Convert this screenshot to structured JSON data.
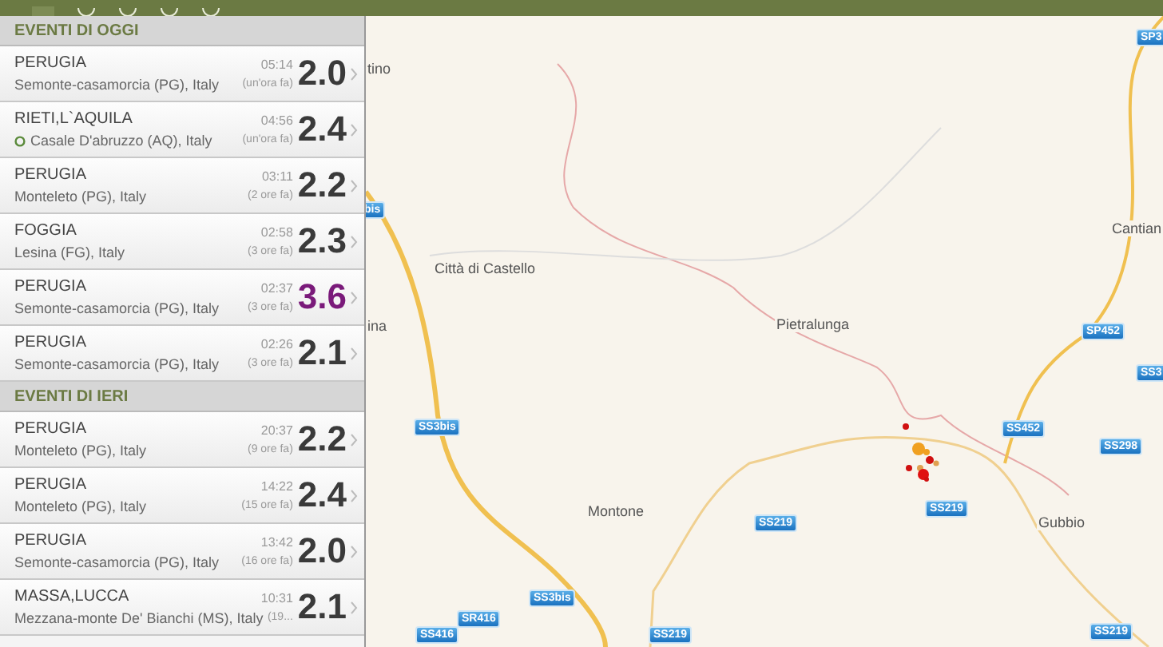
{
  "sections": [
    {
      "title": "EVENTI DI OGGI",
      "events": [
        {
          "region": "PERUGIA",
          "place": "Semonte-casamorcia (PG), Italy",
          "time": "05:14",
          "ago": "(un'ora fa)",
          "magnitude": "2.0",
          "color": "#3a3a3a",
          "marker": false
        },
        {
          "region": "RIETI,L`AQUILA",
          "place": "Casale D'abruzzo (AQ), Italy",
          "time": "04:56",
          "ago": "(un'ora fa)",
          "magnitude": "2.4",
          "color": "#3a3a3a",
          "marker": true
        },
        {
          "region": "PERUGIA",
          "place": "Monteleto (PG), Italy",
          "time": "03:11",
          "ago": "(2 ore fa)",
          "magnitude": "2.2",
          "color": "#3a3a3a",
          "marker": false
        },
        {
          "region": "FOGGIA",
          "place": "Lesina (FG), Italy",
          "time": "02:58",
          "ago": "(3 ore fa)",
          "magnitude": "2.3",
          "color": "#3a3a3a",
          "marker": false
        },
        {
          "region": "PERUGIA",
          "place": "Semonte-casamorcia (PG), Italy",
          "time": "02:37",
          "ago": "(3 ore fa)",
          "magnitude": "3.6",
          "color": "#7a1a7a",
          "marker": false
        },
        {
          "region": "PERUGIA",
          "place": "Semonte-casamorcia (PG), Italy",
          "time": "02:26",
          "ago": "(3 ore fa)",
          "magnitude": "2.1",
          "color": "#3a3a3a",
          "marker": false
        }
      ]
    },
    {
      "title": "EVENTI DI IERI",
      "events": [
        {
          "region": "PERUGIA",
          "place": "Monteleto (PG), Italy",
          "time": "20:37",
          "ago": "(9 ore fa)",
          "magnitude": "2.2",
          "color": "#3a3a3a",
          "marker": false
        },
        {
          "region": "PERUGIA",
          "place": "Monteleto (PG), Italy",
          "time": "14:22",
          "ago": "(15 ore fa)",
          "magnitude": "2.4",
          "color": "#3a3a3a",
          "marker": false
        },
        {
          "region": "PERUGIA",
          "place": "Semonte-casamorcia (PG), Italy",
          "time": "13:42",
          "ago": "(16 ore fa)",
          "magnitude": "2.0",
          "color": "#3a3a3a",
          "marker": false
        },
        {
          "region": "MASSA,LUCCA",
          "place": "Mezzana-monte De' Bianchi (MS), Italy",
          "time": "10:31",
          "ago": "(19...",
          "magnitude": "2.1",
          "color": "#3a3a3a",
          "marker": false
        }
      ]
    }
  ],
  "map": {
    "places": [
      "tino",
      "Città di Castello",
      "ina",
      "Pietralunga",
      "Cantian",
      "Montone",
      "Gubbio"
    ],
    "shields": [
      "SP3",
      "bis",
      "SP452",
      "SS3",
      "SS452",
      "SS298",
      "SS3bis",
      "SS219",
      "SS219",
      "SS3bis",
      "SR416",
      "SS416",
      "SS219",
      "SS219"
    ]
  }
}
